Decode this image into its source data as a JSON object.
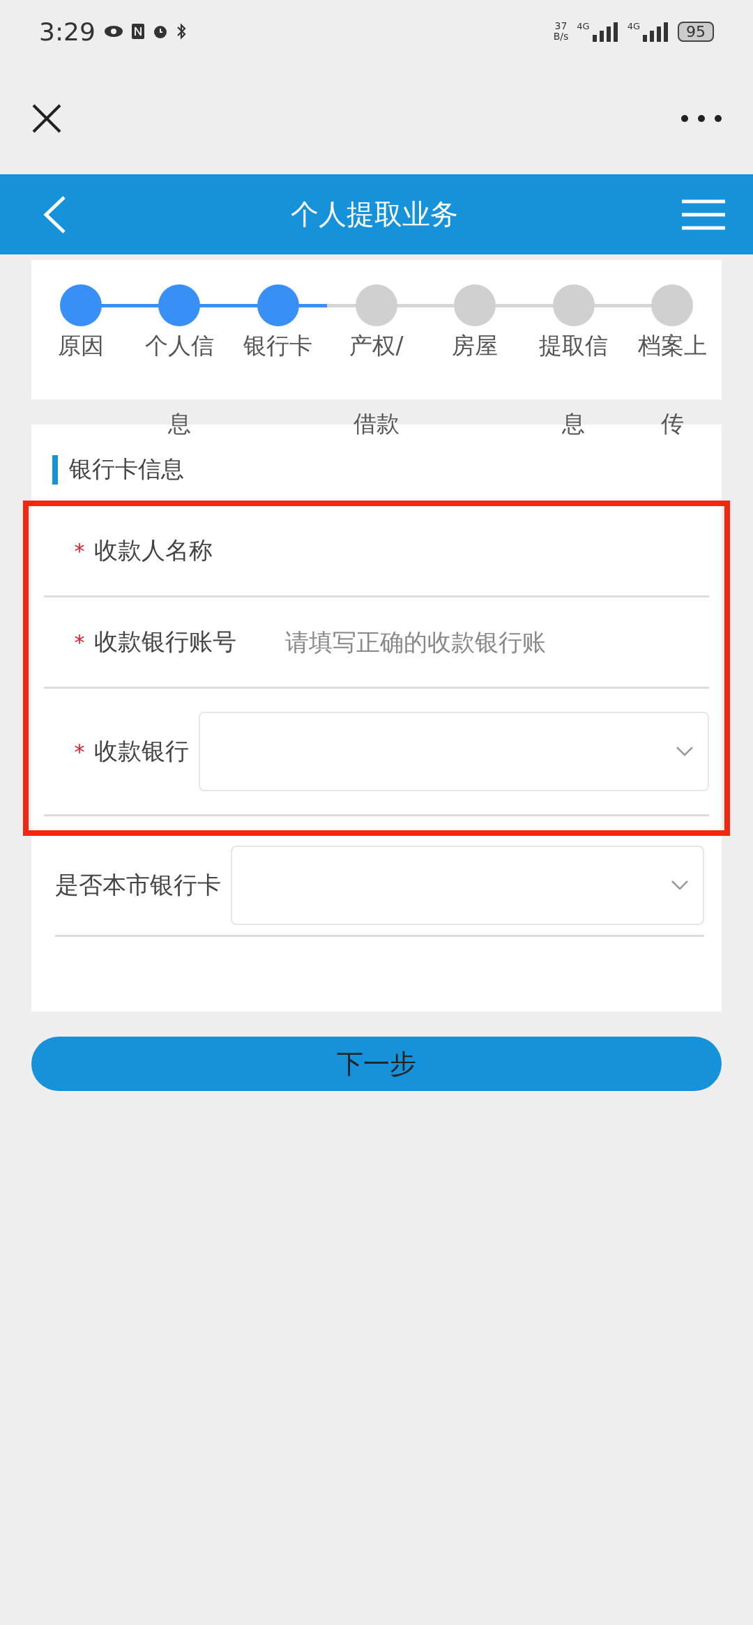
{
  "status_bar": {
    "time": "3:29",
    "net_speed": "37",
    "net_unit": "B/s",
    "networks": [
      "4G",
      "4G"
    ],
    "battery": "95"
  },
  "nav": {
    "title": "个人提取业务"
  },
  "steps": [
    {
      "label": "原因",
      "active": true
    },
    {
      "label": "个人信息",
      "active": true
    },
    {
      "label": "银行卡",
      "active": true
    },
    {
      "label": "产权/借款",
      "active": false
    },
    {
      "label": "房屋",
      "active": false
    },
    {
      "label": "提取信息",
      "active": false
    },
    {
      "label": "档案上传",
      "active": false
    }
  ],
  "section_title": "银行卡信息",
  "fields": [
    {
      "kind": "text",
      "label": "收款人名称",
      "required_mark": "*",
      "highlighted": true
    },
    {
      "kind": "text",
      "label": "收款银行账号",
      "required_mark": "*",
      "placeholder": "请填写正确的收款银行账",
      "highlighted": true
    },
    {
      "kind": "select",
      "label": "收款银行",
      "required_mark": "*",
      "highlighted": true
    },
    {
      "kind": "select",
      "label": "是否本市银行卡",
      "highlighted": false
    }
  ],
  "next_button": "下一步"
}
